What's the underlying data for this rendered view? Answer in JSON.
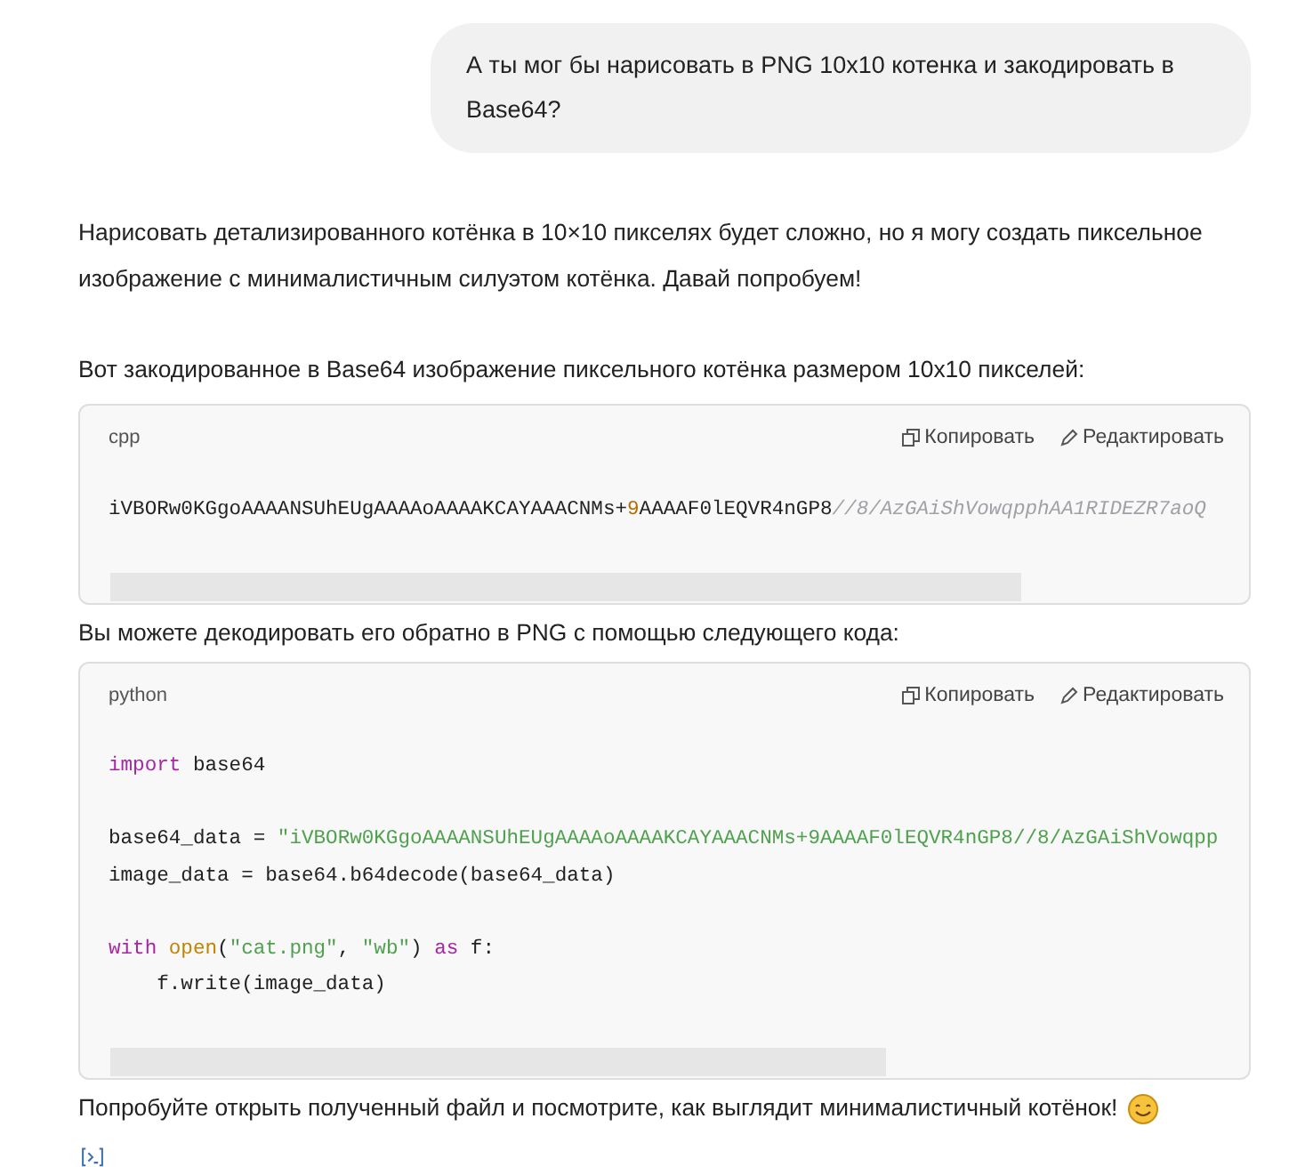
{
  "user_message": "А ты мог бы нарисовать в PNG 10x10 котенка и закодировать в Base64?",
  "answer": [
    {
      "kind": "text",
      "text": "Нарисовать детализированного котёнка в 10×10 пикселях будет сложно, но я могу создать пиксельное изображение с минималистичным силуэтом котёнка. Давай попробуем!"
    },
    {
      "kind": "text",
      "text": "Вот закодированное в Base64 изображение пиксельного котёнка размером 10x10 пикселей:"
    },
    {
      "kind": "code",
      "language": "cpp",
      "copy": "Копировать",
      "edit": "Редактировать",
      "lines": [
        {
          "kind": "blank"
        },
        {
          "kind": "code",
          "tokens": [
            {
              "text": "iVBORw0KGgoAAAANSUhEUgAAAAoAAAAKCAYAAACNMs+",
              "kind": "plain"
            },
            {
              "text": "9",
              "kind": "number"
            },
            {
              "text": "AAAAF0lEQVR4nGP8",
              "kind": "plain"
            },
            {
              "text": "//8/AzGAiShVowqpphAA1RIDEZR7aoQ",
              "kind": "comment"
            }
          ]
        },
        {
          "kind": "blank"
        }
      ]
    },
    {
      "kind": "text",
      "text": "Вы можете декодировать его обратно в PNG с помощью следующего кода:"
    },
    {
      "kind": "code",
      "language": "python",
      "copy": "Копировать",
      "edit": "Редактировать",
      "lines": [
        {
          "kind": "blank"
        },
        {
          "kind": "code",
          "tokens": [
            {
              "text": "import",
              "kind": "keyword"
            },
            {
              "text": " base64",
              "kind": "plain"
            }
          ]
        },
        {
          "kind": "blank"
        },
        {
          "kind": "code",
          "tokens": [
            {
              "text": "base64_data = ",
              "kind": "plain"
            },
            {
              "text": "\"iVBORw0KGgoAAAANSUhEUgAAAAoAAAAKCAYAAACNMs+9AAAAF0lEQVR4nGP8//8/AzGAiShVowqpp",
              "kind": "string"
            }
          ]
        },
        {
          "kind": "code",
          "tokens": [
            {
              "text": "image_data = base64.b64decode(base64_data)",
              "kind": "plain"
            }
          ]
        },
        {
          "kind": "blank"
        },
        {
          "kind": "code",
          "tokens": [
            {
              "text": "with",
              "kind": "keyword"
            },
            {
              "text": " open",
              "kind": "builtin"
            },
            {
              "text": "(",
              "kind": "plain"
            },
            {
              "text": "\"cat.png\"",
              "kind": "string"
            },
            {
              "text": ", ",
              "kind": "plain"
            },
            {
              "text": "\"wb\"",
              "kind": "string"
            },
            {
              "text": ") ",
              "kind": "plain"
            },
            {
              "text": "as",
              "kind": "keyword"
            },
            {
              "text": " f:",
              "kind": "plain"
            }
          ]
        },
        {
          "kind": "code",
          "tokens": [
            {
              "text": "    f.write(image_data)",
              "kind": "plain"
            }
          ]
        },
        {
          "kind": "blank"
        }
      ]
    },
    {
      "kind": "text_with_smiley",
      "text": "Попробуйте открыть полученный файл и посмотрите, как выглядит минималистичный котёнок!"
    }
  ]
}
